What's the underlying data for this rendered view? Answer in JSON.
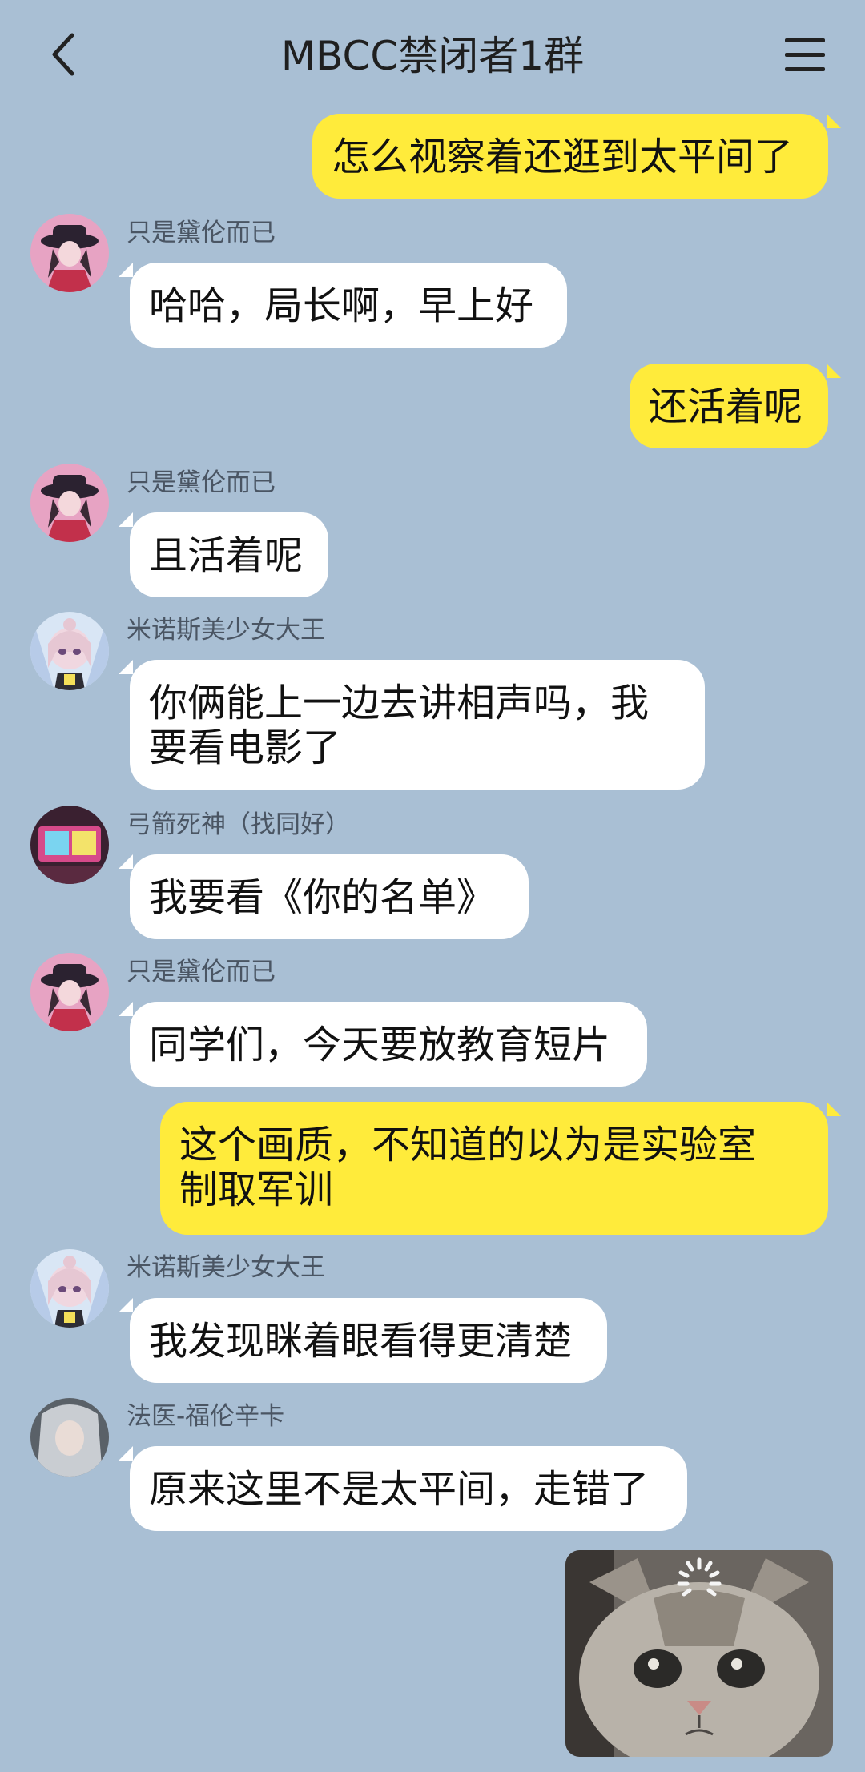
{
  "header": {
    "title": "MBCC禁闭者1群",
    "back_icon": "chevron-left-icon",
    "menu_icon": "hamburger-menu-icon"
  },
  "messages": [
    {
      "side": "out",
      "text": "怎么视察着还逛到太平间了"
    },
    {
      "side": "in",
      "sender": "只是黛伦而已",
      "text": "哈哈，局长啊，早上好"
    },
    {
      "side": "out",
      "text": "还活着呢"
    },
    {
      "side": "in",
      "sender": "只是黛伦而已",
      "text": "且活着呢"
    },
    {
      "side": "in",
      "sender": "米诺斯美少女大王",
      "text_line1": "你俩能上一边去讲相声吗，我",
      "text_line2": "要看电影了"
    },
    {
      "side": "in",
      "sender": "弓箭死神（找同好）",
      "text": "我要看《你的名单》"
    },
    {
      "side": "in",
      "sender": "只是黛伦而已",
      "text": "同学们，今天要放教育短片"
    },
    {
      "side": "out",
      "text_line1": "这个画质，不知道的以为是实验室",
      "text_line2": "制取军训"
    },
    {
      "side": "in",
      "sender": "米诺斯美少女大王",
      "text": "我发现眯着眼看得更清楚"
    },
    {
      "side": "in",
      "sender": "法医-福伦辛卡",
      "text": "原来这里不是太平间，走错了"
    },
    {
      "side": "out",
      "type": "image",
      "image": "cat-photo-loading"
    }
  ]
}
